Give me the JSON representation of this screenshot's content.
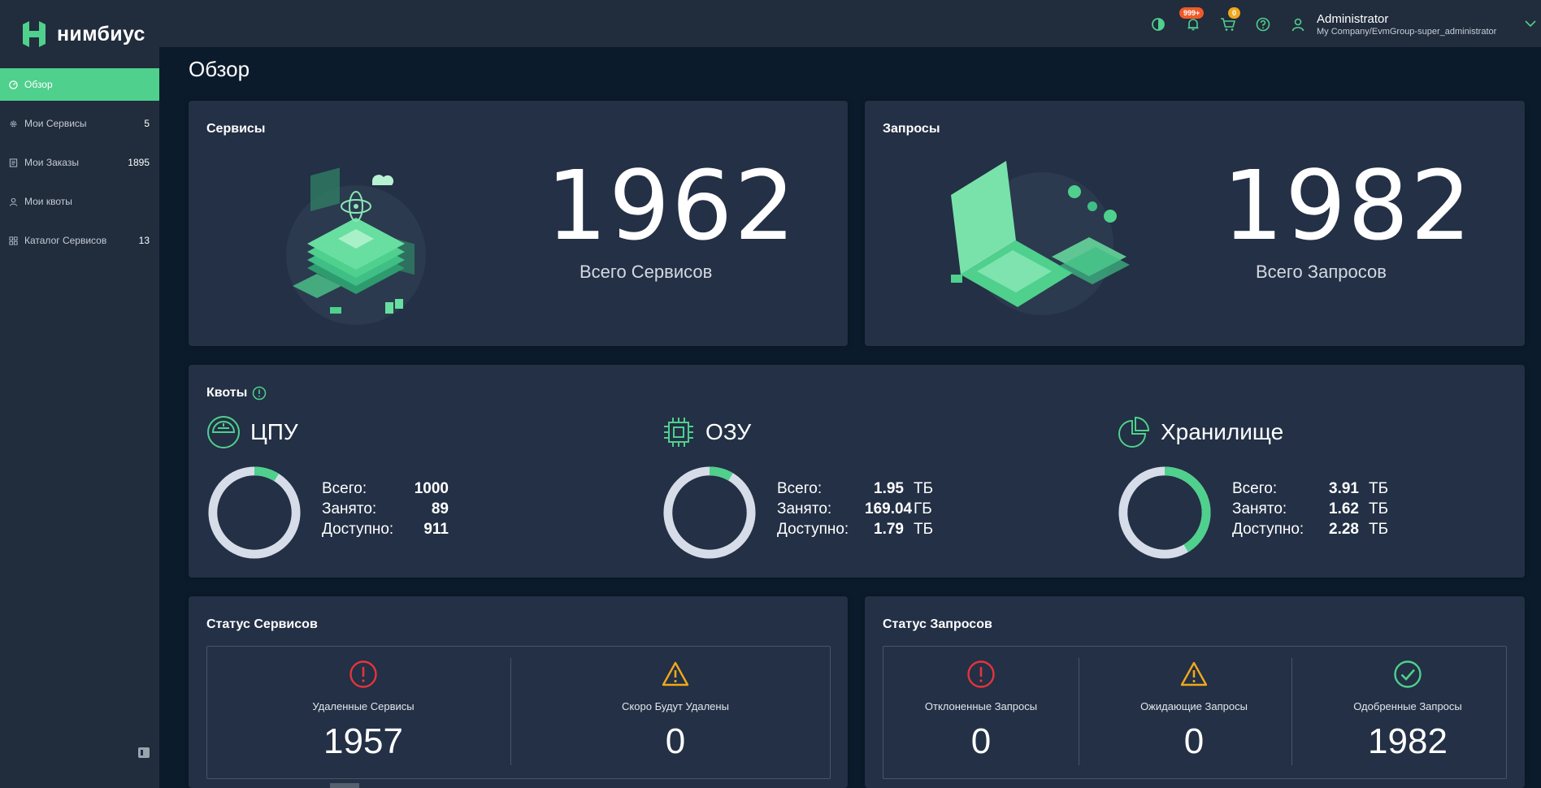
{
  "brand": {
    "name": "нимбиус",
    "color": "#4fd08d"
  },
  "sidebar": {
    "items": [
      {
        "label": "Обзор",
        "count": "",
        "icon": "dashboard-icon",
        "active": true
      },
      {
        "label": "Мои Сервисы",
        "count": "5",
        "icon": "gear-icon"
      },
      {
        "label": "Мои Заказы",
        "count": "1895",
        "icon": "orders-icon"
      },
      {
        "label": "Мои квоты",
        "count": "",
        "icon": "user-icon"
      },
      {
        "label": "Каталог Сервисов",
        "count": "13",
        "icon": "grid-icon"
      }
    ]
  },
  "header": {
    "notifications_badge": "999+",
    "cart_badge": "0",
    "user_name": "Administrator",
    "user_org": "My Company/EvmGroup-super_administrator"
  },
  "page": {
    "title": "Обзор"
  },
  "services_card": {
    "title": "Сервисы",
    "value": "1962",
    "caption": "Всего Сервисов"
  },
  "requests_card": {
    "title": "Запросы",
    "value": "1982",
    "caption": "Всего Запросов"
  },
  "quotas": {
    "title": "Квоты",
    "items": [
      {
        "name": "ЦПУ",
        "icon": "cpu-icon",
        "total_label": "Всего:",
        "total": "1000",
        "total_unit": "",
        "used_label": "Занято:",
        "used": "89",
        "used_unit": "",
        "free_label": "Доступно:",
        "free": "911",
        "free_unit": "",
        "used_fraction": 0.089
      },
      {
        "name": "ОЗУ",
        "icon": "memory-chip-icon",
        "total_label": "Всего:",
        "total": "1.95",
        "total_unit": "ТБ",
        "used_label": "Занято:",
        "used": "169.04",
        "used_unit": "ГБ",
        "free_label": "Доступно:",
        "free": "1.79",
        "free_unit": "ТБ",
        "used_fraction": 0.085
      },
      {
        "name": "Хранилище",
        "icon": "pie-chart-icon",
        "total_label": "Всего:",
        "total": "3.91",
        "total_unit": "ТБ",
        "used_label": "Занято:",
        "used": "1.62",
        "used_unit": "ТБ",
        "free_label": "Доступно:",
        "free": "2.28",
        "free_unit": "ТБ",
        "used_fraction": 0.414
      }
    ]
  },
  "service_status": {
    "title": "Статус Сервисов",
    "items": [
      {
        "label": "Удаленные Сервисы",
        "value": "1957",
        "icon": "error-icon"
      },
      {
        "label": "Скоро Будут Удалены",
        "value": "0",
        "icon": "warning-icon"
      }
    ]
  },
  "request_status": {
    "title": "Статус Запросов",
    "items": [
      {
        "label": "Отклоненные Запросы",
        "value": "0",
        "icon": "error-icon"
      },
      {
        "label": "Ожидающие Запросы",
        "value": "0",
        "icon": "warning-icon"
      },
      {
        "label": "Одобренные Запросы",
        "value": "1982",
        "icon": "check-circle-icon"
      }
    ]
  },
  "colors": {
    "accent": "#4fd08d",
    "error": "#e5343d",
    "warning": "#f0a81c",
    "success": "#4fd08d",
    "donut_track": "#d6dde9"
  }
}
